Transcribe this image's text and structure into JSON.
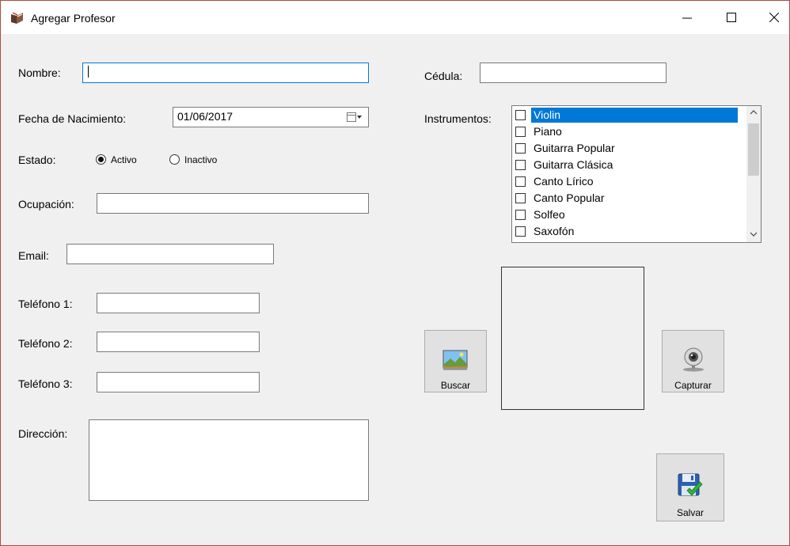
{
  "window": {
    "title": "Agregar Profesor"
  },
  "form": {
    "nombre_label": "Nombre:",
    "nombre_value": "",
    "fecha_label": "Fecha de Nacimiento:",
    "fecha_value": "01/06/2017",
    "estado_label": "Estado:",
    "estado_options": [
      "Activo",
      "Inactivo"
    ],
    "estado_selected": "Activo",
    "ocupacion_label": "Ocupación:",
    "email_label": "Email:",
    "telefono1_label": "Teléfono 1:",
    "telefono2_label": "Teléfono 2:",
    "telefono3_label": "Teléfono 3:",
    "direccion_label": "Dirección:",
    "cedula_label": "Cédula:",
    "instrumentos_label": "Instrumentos:"
  },
  "instrumentos": {
    "items": [
      "Violin",
      "Piano",
      "Guitarra Popular",
      "Guitarra Clásica",
      "Canto Lírico",
      "Canto Popular",
      "Solfeo",
      "Saxofón"
    ],
    "selected": "Violin"
  },
  "buttons": {
    "buscar": "Buscar",
    "capturar": "Capturar",
    "salvar": "Salvar"
  },
  "colors": {
    "selection": "#0078d7",
    "focus_border": "#0078d7"
  }
}
